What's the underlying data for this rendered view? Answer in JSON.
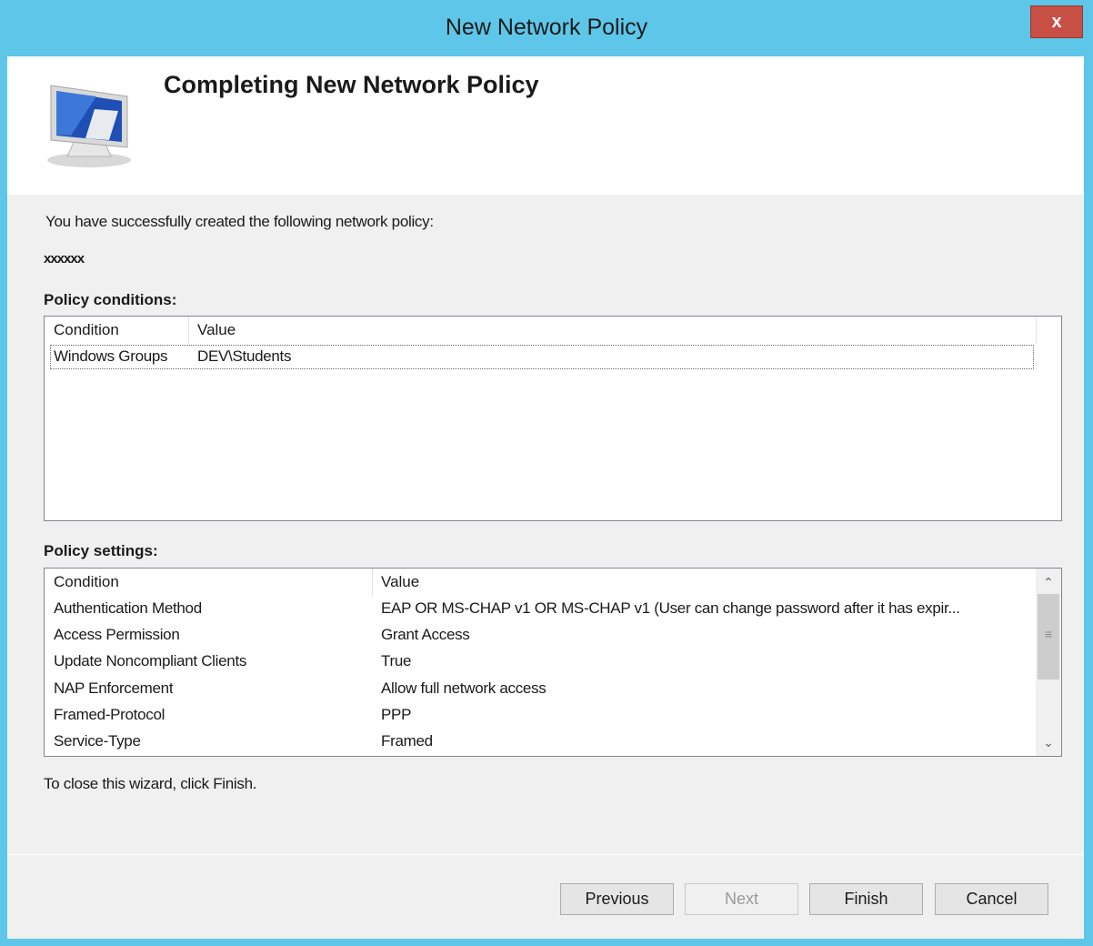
{
  "window": {
    "title": "New Network Policy",
    "close_label": "x"
  },
  "header": {
    "title": "Completing New Network Policy"
  },
  "intro_text": "You have successfully created the following network policy:",
  "policy_name": "xxxxxx",
  "conditions": {
    "label": "Policy conditions:",
    "columns": [
      "Condition",
      "Value"
    ],
    "rows": [
      {
        "condition": "Windows Groups",
        "value": "DEV\\Students"
      }
    ]
  },
  "settings": {
    "label": "Policy settings:",
    "columns": [
      "Condition",
      "Value"
    ],
    "rows": [
      {
        "condition": "Authentication Method",
        "value": "EAP OR MS-CHAP v1 OR MS-CHAP v1 (User can change password after it has expir..."
      },
      {
        "condition": "Access Permission",
        "value": "Grant Access"
      },
      {
        "condition": "Update Noncompliant Clients",
        "value": "True"
      },
      {
        "condition": "NAP Enforcement",
        "value": "Allow full network access"
      },
      {
        "condition": "Framed-Protocol",
        "value": "PPP"
      },
      {
        "condition": "Service-Type",
        "value": "Framed"
      }
    ]
  },
  "footer_note": "To close this wizard, click Finish.",
  "buttons": {
    "previous": "Previous",
    "next": "Next",
    "finish": "Finish",
    "cancel": "Cancel"
  },
  "icons": {
    "header": "computer-monitor-icon",
    "scroll_up": "chevron-up-icon",
    "scroll_down": "chevron-down-icon"
  }
}
